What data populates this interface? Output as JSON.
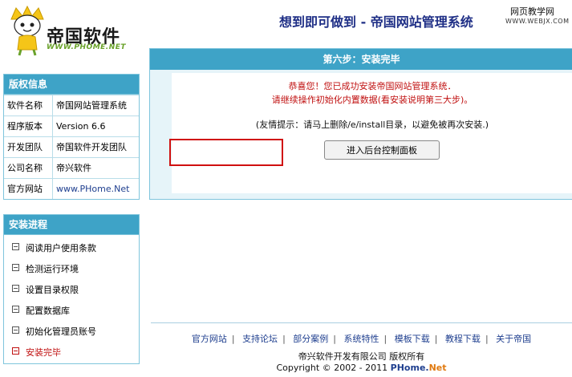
{
  "header": {
    "logo_text": "帝国软件",
    "logo_url": "WWW.PHOME.NET",
    "title": "想到即可做到  - 帝国网站管理系统",
    "watermark_top": "网页教学网",
    "watermark_bottom": "WWW.WEBJX.COM"
  },
  "info_box": {
    "title": "版权信息",
    "rows": [
      {
        "key": "软件名称",
        "value": "帝国网站管理系统"
      },
      {
        "key": "程序版本",
        "value": "Version 6.6"
      },
      {
        "key": "开发团队",
        "value": "帝国软件开发团队"
      },
      {
        "key": "公司名称",
        "value": "帝兴软件"
      },
      {
        "key": "官方网站",
        "value": "www.PHome.Net"
      }
    ]
  },
  "steps_box": {
    "title": "安装进程",
    "steps": [
      {
        "label": "阅读用户使用条款",
        "active": false
      },
      {
        "label": "检测运行环境",
        "active": false
      },
      {
        "label": "设置目录权限",
        "active": false
      },
      {
        "label": "配置数据库",
        "active": false
      },
      {
        "label": "初始化管理员账号",
        "active": false
      },
      {
        "label": "安装完毕",
        "active": true
      }
    ]
  },
  "main": {
    "heading": "第六步：安装完毕",
    "congrats_line1": "恭喜您！您已成功安装帝国网站管理系统．",
    "congrats_line2": "请继续操作初始化内置数据(看安装说明第三大步)。",
    "hint": "(友情提示：请马上删除/e/install目录，以避免被再次安装.)",
    "enter_button": "进入后台控制面板"
  },
  "footer": {
    "links": [
      "官方网站",
      "支持论坛",
      "部分案例",
      "系统特性",
      "模板下载",
      "教程下载",
      "关于帝国"
    ],
    "company": "帝兴软件开发有限公司  版权所有",
    "copyright_prefix": "Copyright © 2002 - 2011 ",
    "copyright_brand": "PHome.",
    "copyright_brand_net": "Net"
  },
  "colors": {
    "accent": "#3ea3c7",
    "title_blue": "#1f2f86",
    "alert_red": "#c01010"
  }
}
